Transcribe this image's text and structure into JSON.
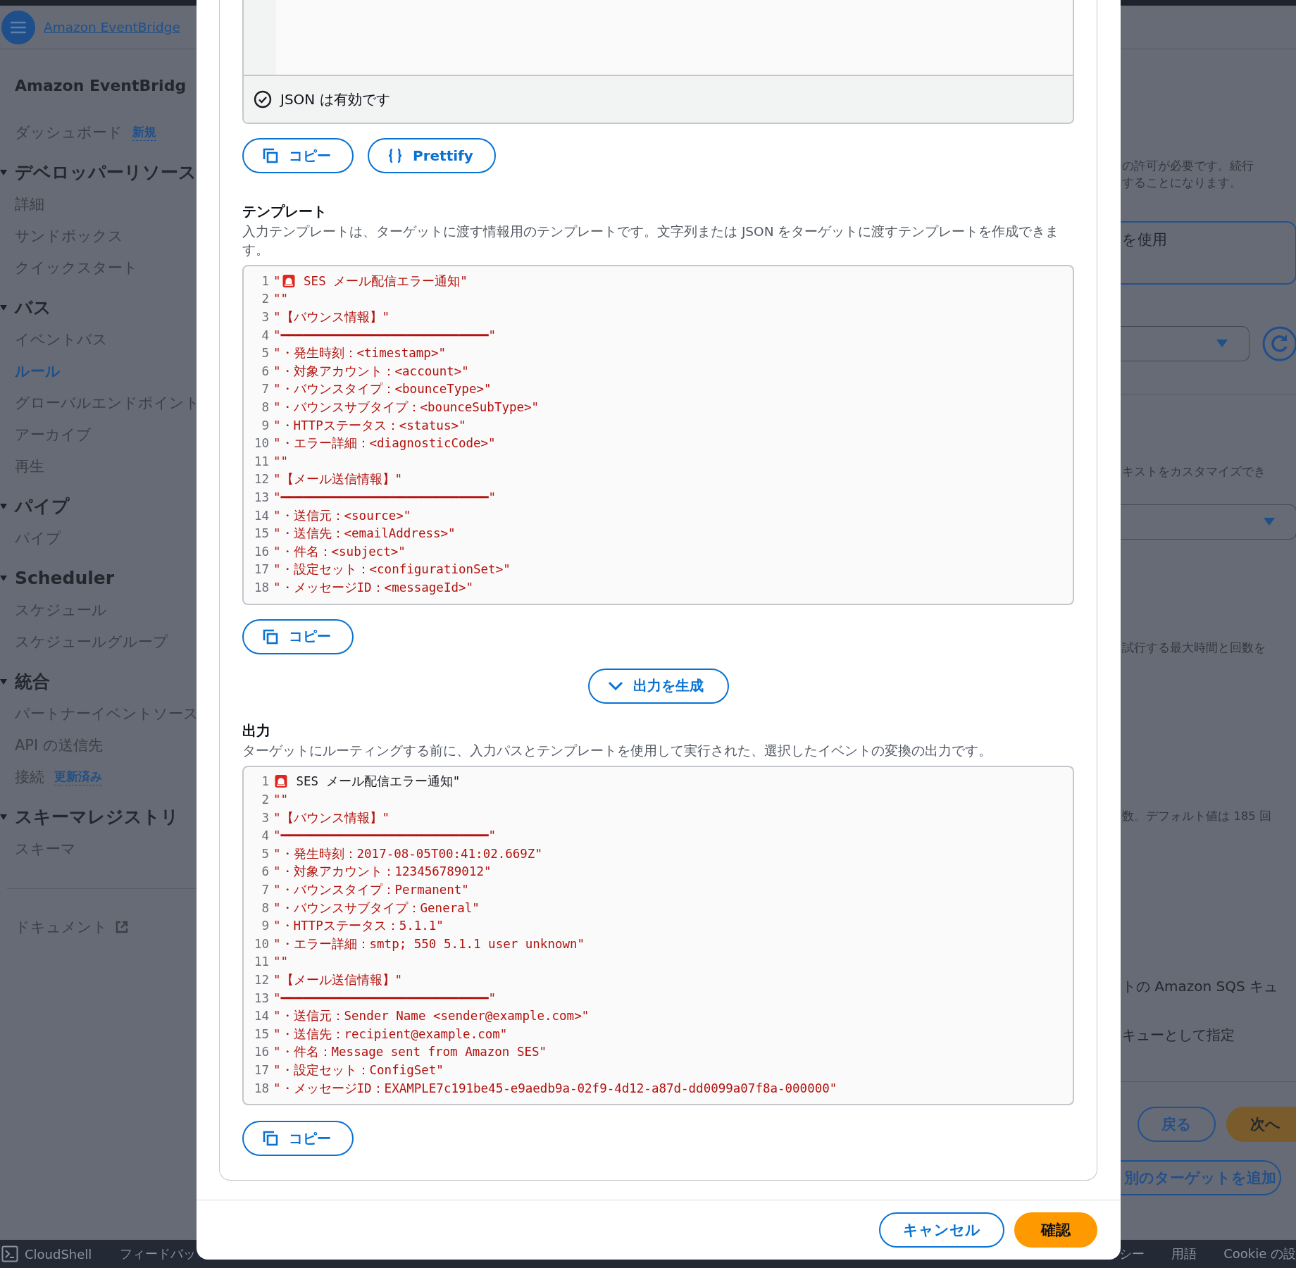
{
  "top_nav": {
    "service_link": "Amazon EventBridge"
  },
  "sidebar": {
    "title": "Amazon EventBridg",
    "groups": [
      {
        "items": [
          {
            "label": "ダッシュボード",
            "badge": "新規",
            "selected": false
          }
        ]
      },
      {
        "heading": "デベロッパーリソース",
        "expanded": true,
        "items": [
          {
            "label": "詳細",
            "selected": false
          },
          {
            "label": "サンドボックス",
            "selected": false
          },
          {
            "label": "クイックスタート",
            "selected": false
          }
        ]
      },
      {
        "heading": "バス",
        "expanded": true,
        "items": [
          {
            "label": "イベントバス",
            "selected": false
          },
          {
            "label": "ルール",
            "selected": true
          },
          {
            "label": "グローバルエンドポイント",
            "selected": false
          },
          {
            "label": "アーカイブ",
            "selected": false
          },
          {
            "label": "再生",
            "selected": false
          }
        ]
      },
      {
        "heading": "パイプ",
        "expanded": true,
        "items": [
          {
            "label": "パイプ",
            "selected": false
          }
        ]
      },
      {
        "heading": "Scheduler",
        "expanded": true,
        "items": [
          {
            "label": "スケジュール",
            "selected": false
          },
          {
            "label": "スケジュールグループ",
            "selected": false
          }
        ]
      },
      {
        "heading": "統合",
        "expanded": true,
        "items": [
          {
            "label": "パートナーイベントソース",
            "selected": false
          },
          {
            "label": "API の送信先",
            "selected": false
          },
          {
            "label": "接続",
            "badge": "更新済み",
            "selected": false
          }
        ]
      },
      {
        "heading": "スキーマレジストリ",
        "expanded": true,
        "items": [
          {
            "label": "スキーマ",
            "selected": false
          }
        ]
      }
    ],
    "document_link": "ドキュメント"
  },
  "background": [
    {
      "kind": "text",
      "text": "の許可が必要です。続行"
    },
    {
      "kind": "text",
      "text": "することになります。"
    },
    {
      "kind": "option",
      "text": "を使用"
    },
    {
      "kind": "select"
    },
    {
      "kind": "divider"
    },
    {
      "kind": "text",
      "text": "キストをカスタマイズでき"
    },
    {
      "kind": "select"
    },
    {
      "kind": "text",
      "text": "試行する最大時間と回数を"
    },
    {
      "kind": "text",
      "text": "数。デフォルト値は 185 回"
    },
    {
      "kind": "text",
      "text": "トの Amazon SQS キュ",
      "large": true
    },
    {
      "kind": "text",
      "text": "キューとして指定",
      "large": true
    },
    {
      "kind": "divider"
    },
    {
      "kind": "buttons",
      "buttons": [
        {
          "label": "戻る",
          "primary": false
        },
        {
          "label": "次へ",
          "primary": true
        }
      ]
    },
    {
      "kind": "button",
      "label": "別のターゲットを追加"
    }
  ],
  "modal": {
    "json_editor": {
      "status": "JSON は有効です",
      "valid": true
    },
    "json_buttons": [
      {
        "kind": "copy",
        "label": "コピー"
      },
      {
        "kind": "prettify",
        "label": "Prettify"
      }
    ],
    "template": {
      "heading": "テンプレート",
      "description": "入力テンプレートは、ターゲットに渡す情報用のテンプレートです。文字列または JSON をターゲットに渡すテンプレートを作成できます。",
      "lines": [
        {
          "num": "1",
          "kind": "alert",
          "pre": "\"",
          "text": " SES メール配信エラー通知\""
        },
        {
          "num": "2",
          "text": "\"\""
        },
        {
          "num": "3",
          "text": "\"【バウンス情報】\""
        },
        {
          "num": "4",
          "text": "\"━━━━━━━━━━━━━━━━━━━━━━━━━━━━\""
        },
        {
          "num": "5",
          "text": "\"・発生時刻：<timestamp>\""
        },
        {
          "num": "6",
          "text": "\"・対象アカウント：<account>\""
        },
        {
          "num": "7",
          "text": "\"・バウンスタイプ：<bounceType>\""
        },
        {
          "num": "8",
          "text": "\"・バウンスサブタイプ：<bounceSubType>\""
        },
        {
          "num": "9",
          "text": "\"・HTTPステータス：<status>\""
        },
        {
          "num": "10",
          "text": "\"・エラー詳細：<diagnosticCode>\""
        },
        {
          "num": "11",
          "text": "\"\""
        },
        {
          "num": "12",
          "text": "\"【メール送信情報】\""
        },
        {
          "num": "13",
          "text": "\"━━━━━━━━━━━━━━━━━━━━━━━━━━━━\""
        },
        {
          "num": "14",
          "text": "\"・送信元：<source>\""
        },
        {
          "num": "15",
          "text": "\"・送信先：<emailAddress>\""
        },
        {
          "num": "16",
          "text": "\"・件名：<subject>\""
        },
        {
          "num": "17",
          "text": "\"・設定セット：<configurationSet>\""
        },
        {
          "num": "18",
          "text": "\"・メッセージID：<messageId>\""
        }
      ],
      "copy_label": "コピー"
    },
    "generate_label": "出力を生成",
    "output": {
      "heading": "出力",
      "description": "ターゲットにルーティングする前に、入力パスとテンプレートを使用して実行された、選択したイベントの変換の出力です。",
      "lines": [
        {
          "num": "1",
          "kind": "title",
          "text": " SES メール配信エラー通知\""
        },
        {
          "num": "2",
          "text": "\"\""
        },
        {
          "num": "3",
          "text": "\"【バウンス情報】\""
        },
        {
          "num": "4",
          "text": "\"━━━━━━━━━━━━━━━━━━━━━━━━━━━━\""
        },
        {
          "num": "5",
          "text": "\"・発生時刻：2017-08-05T00:41:02.669Z\""
        },
        {
          "num": "6",
          "text": "\"・対象アカウント：123456789012\""
        },
        {
          "num": "7",
          "text": "\"・バウンスタイプ：Permanent\""
        },
        {
          "num": "8",
          "text": "\"・バウンスサブタイプ：General\""
        },
        {
          "num": "9",
          "text": "\"・HTTPステータス：5.1.1\""
        },
        {
          "num": "10",
          "text": "\"・エラー詳細：smtp; 550 5.1.1 user unknown\""
        },
        {
          "num": "11",
          "text": "\"\""
        },
        {
          "num": "12",
          "text": "\"【メール送信情報】\""
        },
        {
          "num": "13",
          "text": "\"━━━━━━━━━━━━━━━━━━━━━━━━━━━━\""
        },
        {
          "num": "14",
          "text": "\"・送信元：Sender Name <sender@example.com>\""
        },
        {
          "num": "15",
          "text": "\"・送信先：recipient@example.com\""
        },
        {
          "num": "16",
          "text": "\"・件名：Message sent from Amazon SES\""
        },
        {
          "num": "17",
          "text": "\"・設定セット：ConfigSet\""
        },
        {
          "num": "18",
          "text": "\"・メッセージID：EXAMPLE7c191be45-e9aedb9a-02f9-4d12-a87d-dd0099a07f8a-000000\""
        }
      ],
      "copy_label": "コピー"
    },
    "footer_buttons": [
      {
        "label": "キャンセル",
        "primary": false
      },
      {
        "label": "確認",
        "primary": true
      }
    ]
  },
  "footer": {
    "left": [
      "CloudShell",
      "フィードバッ"
    ],
    "right": [
      "シー",
      "用語",
      "Cookie の設"
    ]
  }
}
